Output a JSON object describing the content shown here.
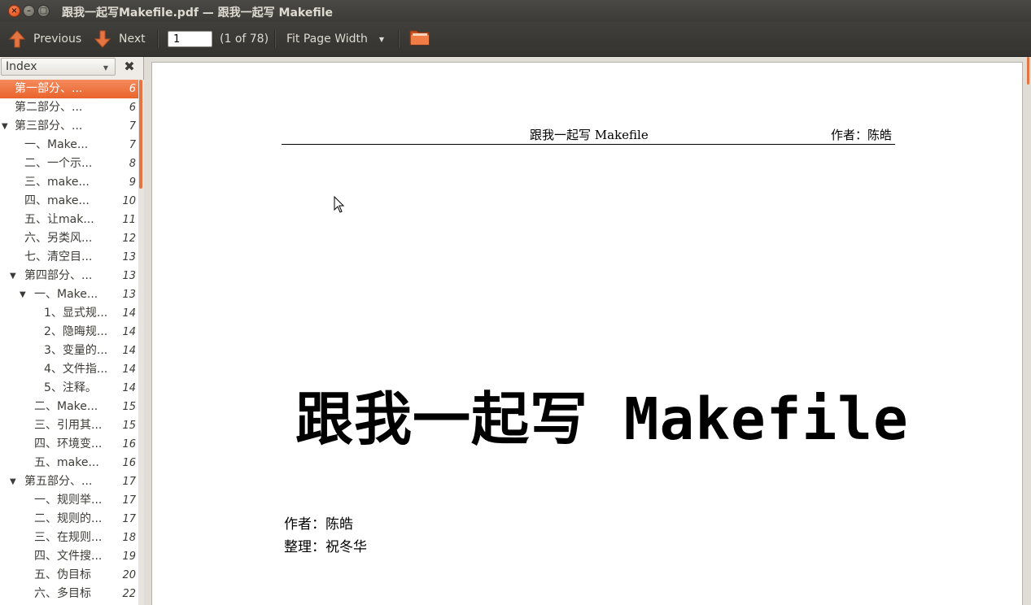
{
  "window": {
    "title": "跟我一起写Makefile.pdf — 跟我一起写 Makefile",
    "close_glyph": "×",
    "min_glyph": "–",
    "max_glyph": "□"
  },
  "toolbar": {
    "previous_label": "Previous",
    "next_label": "Next",
    "page_value": "1",
    "page_count": "(1 of 78)",
    "zoom_label": "Fit Page Width",
    "dropdown_glyph": "▼"
  },
  "sidebar": {
    "view_selector": "Index",
    "close_glyph": "✖",
    "items": [
      {
        "label": "第一部分、...",
        "page": "6",
        "level": 0,
        "expander": ""
      },
      {
        "label": "第二部分、...",
        "page": "6",
        "level": 0,
        "expander": ""
      },
      {
        "label": "第三部分、...",
        "page": "7",
        "level": 0,
        "expander": "▼"
      },
      {
        "label": "一、Make...",
        "page": "7",
        "level": 1,
        "expander": ""
      },
      {
        "label": "二、一个示...",
        "page": "8",
        "level": 1,
        "expander": ""
      },
      {
        "label": "三、make...",
        "page": "9",
        "level": 1,
        "expander": ""
      },
      {
        "label": "四、make...",
        "page": "10",
        "level": 1,
        "expander": ""
      },
      {
        "label": "五、让mak...",
        "page": "11",
        "level": 1,
        "expander": ""
      },
      {
        "label": "六、另类风...",
        "page": "12",
        "level": 1,
        "expander": ""
      },
      {
        "label": "七、清空目...",
        "page": "13",
        "level": 1,
        "expander": ""
      },
      {
        "label": "第四部分、...",
        "page": "13",
        "level": 1,
        "expander": "▼"
      },
      {
        "label": "一、Make...",
        "page": "13",
        "level": 2,
        "expander": "▼"
      },
      {
        "label": "1、显式规...",
        "page": "14",
        "level": 3,
        "expander": ""
      },
      {
        "label": "2、隐晦规...",
        "page": "14",
        "level": 3,
        "expander": ""
      },
      {
        "label": "3、变量的...",
        "page": "14",
        "level": 3,
        "expander": ""
      },
      {
        "label": "4、文件指...",
        "page": "14",
        "level": 3,
        "expander": ""
      },
      {
        "label": "5、注释。",
        "page": "14",
        "level": 3,
        "expander": ""
      },
      {
        "label": "二、Make...",
        "page": "15",
        "level": 2,
        "expander": ""
      },
      {
        "label": "三、引用其...",
        "page": "15",
        "level": 2,
        "expander": ""
      },
      {
        "label": "四、环境变...",
        "page": "16",
        "level": 2,
        "expander": ""
      },
      {
        "label": "五、make...",
        "page": "16",
        "level": 2,
        "expander": ""
      },
      {
        "label": "第五部分、...",
        "page": "17",
        "level": 1,
        "expander": "▼"
      },
      {
        "label": "一、规则举...",
        "page": "17",
        "level": 2,
        "expander": ""
      },
      {
        "label": "二、规则的...",
        "page": "17",
        "level": 2,
        "expander": ""
      },
      {
        "label": "三、在规则...",
        "page": "18",
        "level": 2,
        "expander": ""
      },
      {
        "label": "四、文件搜...",
        "page": "19",
        "level": 2,
        "expander": ""
      },
      {
        "label": "五、伪目标",
        "page": "20",
        "level": 2,
        "expander": ""
      },
      {
        "label": "六、多目标",
        "page": "22",
        "level": 2,
        "expander": ""
      }
    ]
  },
  "document": {
    "header_title": "跟我一起写 Makefile",
    "header_author": "作者：陈皓",
    "main_title": "跟我一起写 Makefile",
    "author_line": "作者：陈皓",
    "editor_line": "整理：祝冬华"
  }
}
